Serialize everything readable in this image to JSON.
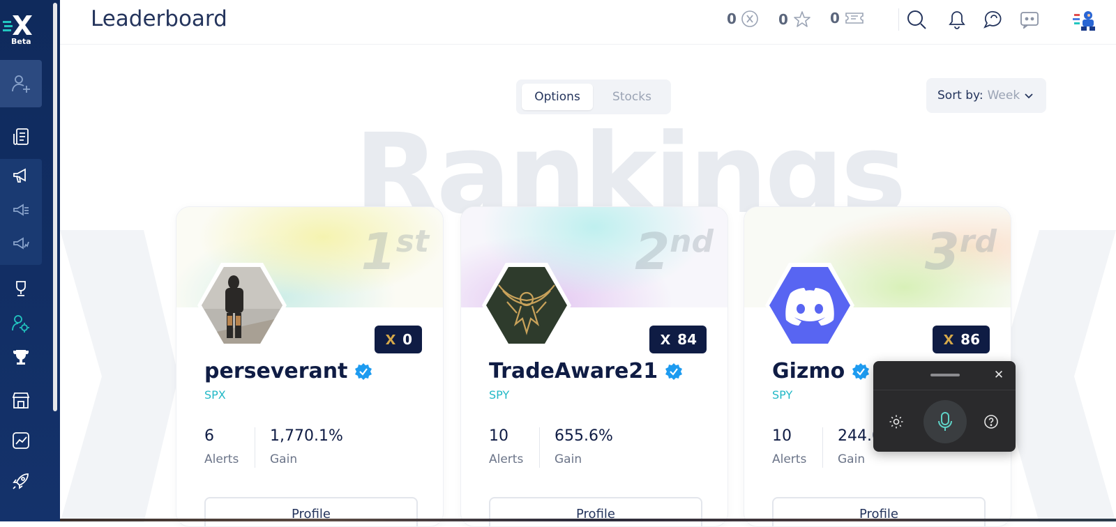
{
  "sidebar": {
    "logo_badge": "Beta",
    "icons": [
      "add-user-icon",
      "feed-icon",
      "megaphone-icon",
      "megaphone-list-icon",
      "megaphone-chart-icon",
      "trophy-outline-icon",
      "user-settings-icon",
      "trophy-icon",
      "store-icon",
      "chart-icon",
      "rocket-icon"
    ]
  },
  "header": {
    "title": "Leaderboard",
    "counters": [
      {
        "value": "0",
        "icon": "x-coin-icon"
      },
      {
        "value": "0",
        "icon": "star-icon"
      },
      {
        "value": "0",
        "icon": "ticket-icon"
      }
    ]
  },
  "watermark": "Rankings",
  "tabs": {
    "options": "Options",
    "stocks": "Stocks",
    "active": "Options"
  },
  "sort": {
    "label": "Sort by:",
    "value": "Week"
  },
  "leaders": [
    {
      "rank": "1",
      "suffix": "st",
      "score": "0",
      "username": "perseverant",
      "ticker": "SPX",
      "alerts": "6",
      "alerts_label": "Alerts",
      "gain": "1,770.1%",
      "gain_label": "Gain",
      "profile": "Profile"
    },
    {
      "rank": "2",
      "suffix": "nd",
      "score": "84",
      "username": "TradeAware21",
      "ticker": "SPY",
      "alerts": "10",
      "alerts_label": "Alerts",
      "gain": "655.6%",
      "gain_label": "Gain",
      "profile": "Profile"
    },
    {
      "rank": "3",
      "suffix": "rd",
      "score": "86",
      "username": "Gizmo",
      "ticker": "SPY",
      "alerts": "10",
      "alerts_label": "Alerts",
      "gain": "244.0",
      "gain_label": "Gain",
      "profile": "Profile"
    }
  ],
  "colors": {
    "navy": "#0f1c44",
    "sidebar": "#14326b",
    "teal": "#22b8c6",
    "gold": "#d6a94a",
    "discord": "#5865f2"
  }
}
